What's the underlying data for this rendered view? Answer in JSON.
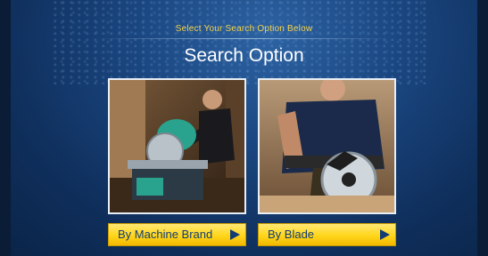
{
  "header": {
    "subtitle": "Select Your Search Option Below",
    "title": "Search Option"
  },
  "options": [
    {
      "label": "By Machine Brand",
      "image": "miter-saw-photo",
      "icon": "play-arrow-icon"
    },
    {
      "label": "By Blade",
      "image": "circular-saw-photo",
      "icon": "play-arrow-icon"
    }
  ],
  "colors": {
    "background": "#1a4680",
    "accent_text": "#f5d34a",
    "button_fill": "#ffd61a",
    "button_text": "#123c74"
  }
}
